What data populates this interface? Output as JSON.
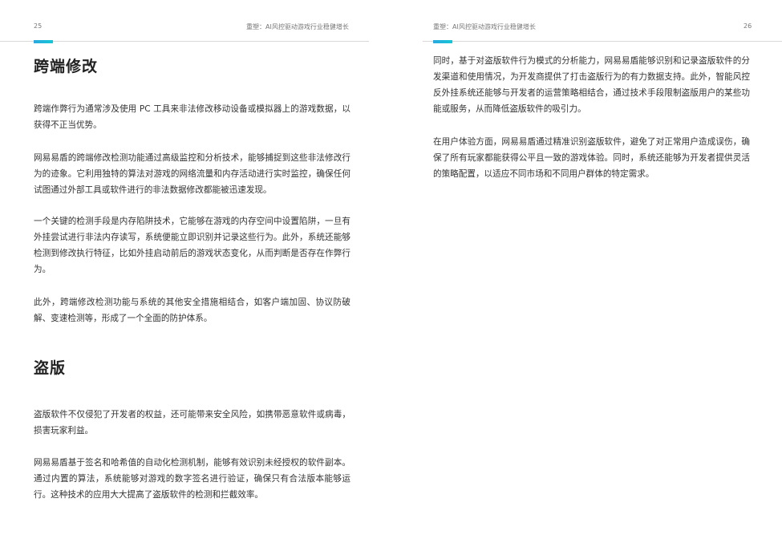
{
  "left_page": {
    "page_number": "25",
    "running_title": "重塑：AI风控驱动游戏行业稳健增长",
    "section1_title": "跨端修改",
    "section1_paragraphs": [
      "跨端作弊行为通常涉及使用 PC 工具来非法修改移动设备或模拟器上的游戏数据，以获得不正当优势。",
      "网易易盾的跨端修改检测功能通过高级监控和分析技术，能够捕捉到这些非法修改行为的迹象。它利用独特的算法对游戏的网络流量和内存活动进行实时监控，确保任何试图通过外部工具或软件进行的非法数据修改都能被迅速发现。",
      "一个关键的检测手段是内存陷阱技术，它能够在游戏的内存空间中设置陷阱，一旦有外挂尝试进行非法内存读写，系统便能立即识别并记录这些行为。此外，系统还能够检测到修改执行特征，比如外挂启动前后的游戏状态变化，从而判断是否存在作弊行为。",
      "此外，跨端修改检测功能与系统的其他安全措施相结合，如客户端加固、协议防破解、变速检测等，形成了一个全面的防护体系。"
    ],
    "section2_title": "盗版",
    "section2_paragraphs": [
      "盗版软件不仅侵犯了开发者的权益，还可能带来安全风险，如携带恶意软件或病毒，损害玩家利益。",
      "网易易盾基于签名和哈希值的自动化检测机制，能够有效识别未经授权的软件副本。通过内置的算法，系统能够对游戏的数字签名进行验证，确保只有合法版本能够运行。这种技术的应用大大提高了盗版软件的检测和拦截效率。"
    ]
  },
  "right_page": {
    "page_number": "26",
    "running_title": "重塑：AI风控驱动游戏行业稳健增长",
    "paragraphs": [
      "同时，基于对盗版软件行为模式的分析能力，网易易盾能够识别和记录盗版软件的分发渠道和使用情况，为开发商提供了打击盗版行为的有力数据支持。此外，智能风控反外挂系统还能够与开发者的运营策略相结合，通过技术手段限制盗版用户的某些功能或服务，从而降低盗版软件的吸引力。",
      "在用户体验方面，网易易盾通过精准识别盗版软件，避免了对正常用户造成误伤，确保了所有玩家都能获得公平且一致的游戏体验。同时，系统还能够为开发者提供灵活的策略配置，以适应不同市场和不同用户群体的特定需求。"
    ]
  },
  "colors": {
    "accent": "#2aa8e0",
    "rule": "#d8d8d8"
  }
}
